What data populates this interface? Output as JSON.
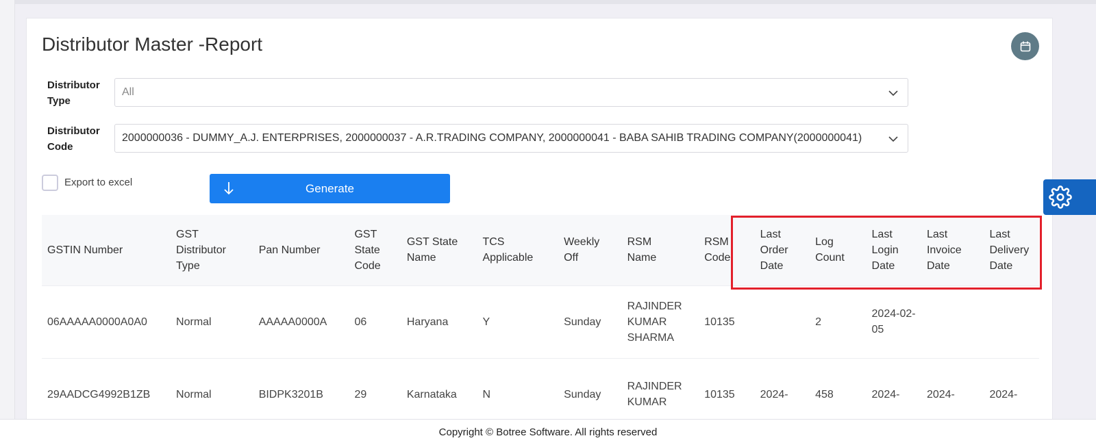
{
  "page": {
    "title": "Distributor Master -Report"
  },
  "filters": {
    "distributor_type": {
      "label_1": "Distributor",
      "label_2": "Type",
      "value": "All"
    },
    "distributor_code": {
      "label_1": "Distributor",
      "label_2": "Code",
      "value": "2000000036 - DUMMY_A.J. ENTERPRISES, 2000000037 - A.R.TRADING COMPANY, 2000000041 - BABA SAHIB TRADING COMPANY(2000000041)"
    }
  },
  "export": {
    "label": "Export to excel",
    "checked": false
  },
  "generate": {
    "label": "Generate"
  },
  "table": {
    "columns": [
      [
        "GSTIN Number"
      ],
      [
        "GST",
        "Distributor",
        "Type"
      ],
      [
        "Pan Number"
      ],
      [
        "GST",
        "State",
        "Code"
      ],
      [
        "GST State",
        "Name"
      ],
      [
        "TCS",
        "Applicable"
      ],
      [
        "Weekly",
        "Off"
      ],
      [
        "RSM",
        "Name"
      ],
      [
        "RSM",
        "Code"
      ],
      [
        "Last",
        "Order",
        "Date"
      ],
      [
        "Log",
        "Count"
      ],
      [
        "Last",
        "Login",
        "Date"
      ],
      [
        "Last",
        "Invoice",
        "Date"
      ],
      [
        "Last",
        "Delivery",
        "Date"
      ]
    ],
    "rows": [
      [
        "06AAAAA0000A0A0",
        "Normal",
        "AAAAA0000A",
        "06",
        "Haryana",
        "Y",
        "Sunday",
        "RAJINDER KUMAR SHARMA",
        "10135",
        "",
        "2",
        "2024-02-05",
        "",
        ""
      ],
      [
        "29AADCG4992B1ZB",
        "Normal",
        "BIDPK3201B",
        "29",
        "Karnataka",
        "N",
        "Sunday",
        "RAJINDER KUMAR",
        "10135",
        "2024-",
        "458",
        "2024-",
        "2024-",
        "2024-"
      ]
    ]
  },
  "highlight_color": "#e3202b",
  "accent_color": "#1a7ff0",
  "icons": {
    "calendar": "calendar-icon",
    "settings": "gear-icon",
    "dropdown": "chevron-down-icon",
    "generate": "arrow-down-icon"
  },
  "footer": {
    "text": "Copyright © Botree Software. All rights reserved"
  }
}
